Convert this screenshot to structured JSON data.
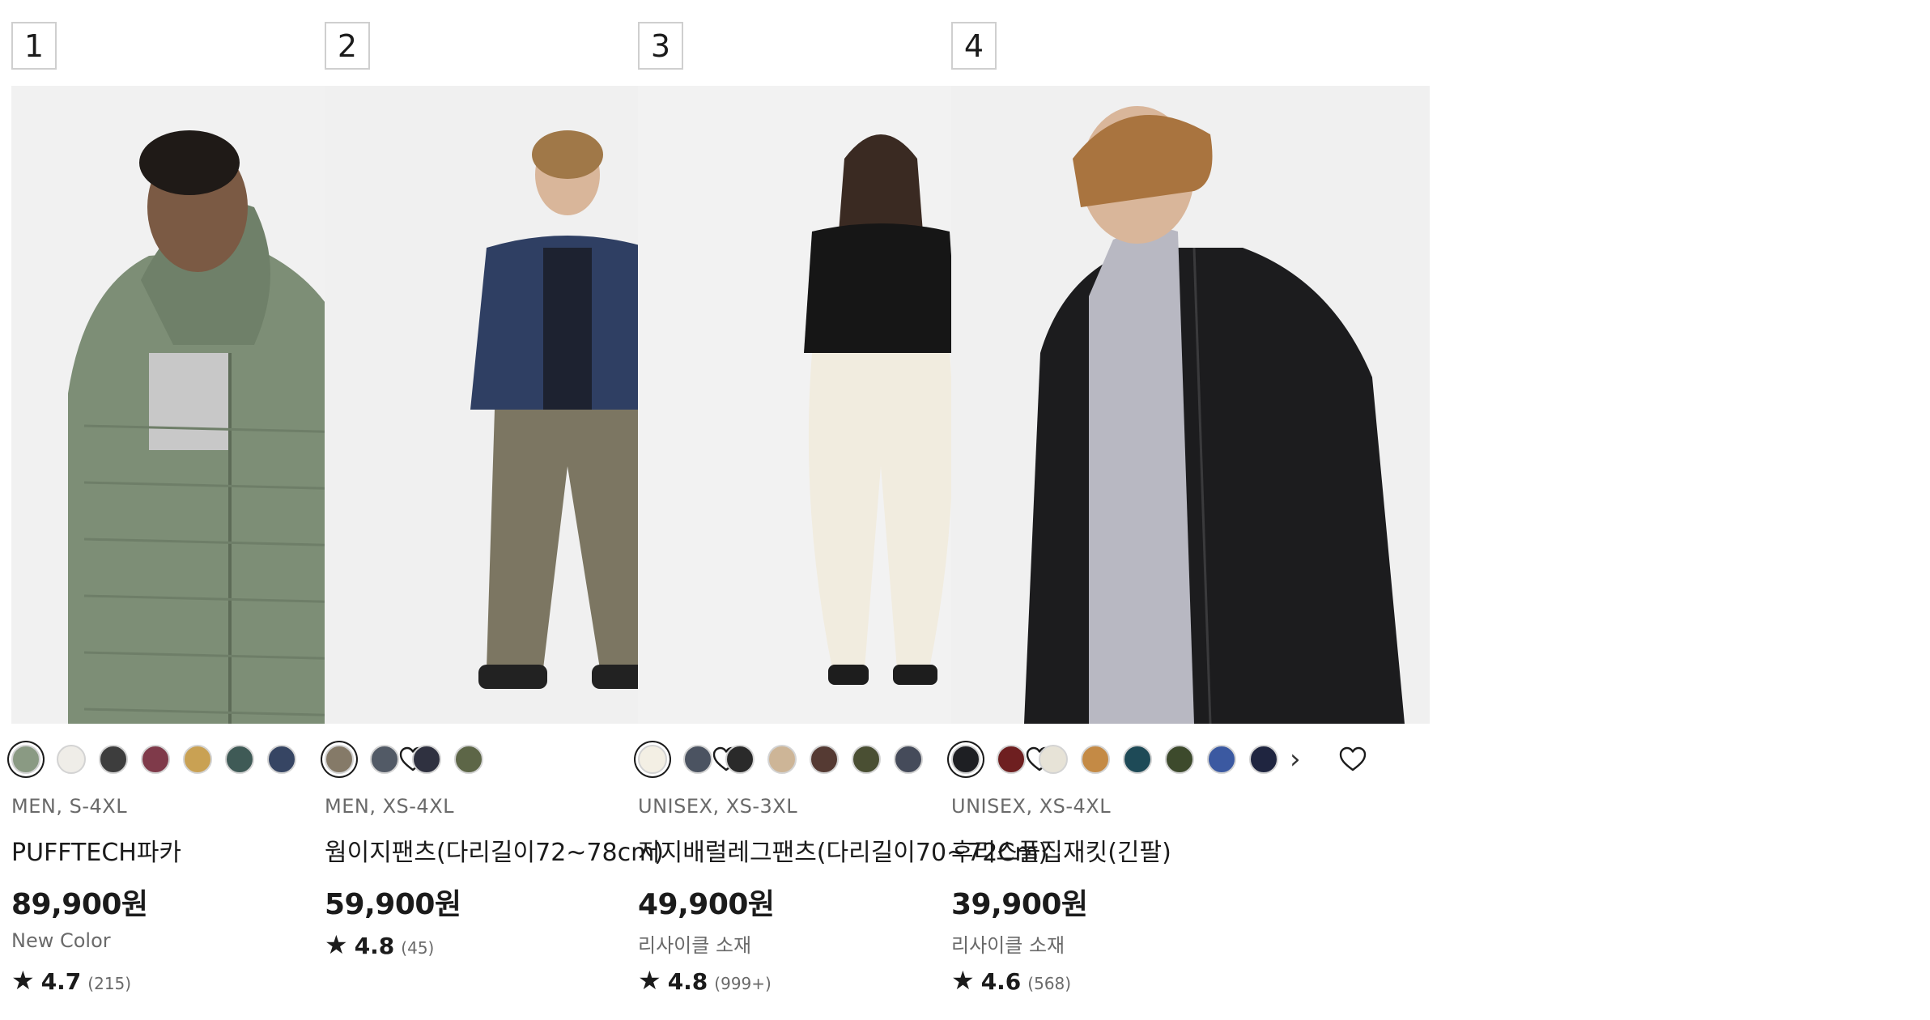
{
  "products": [
    {
      "rank": "1",
      "meta": "MEN, S-4XL",
      "name": "PUFFTECH파카",
      "price": "89,900원",
      "note": "New Color",
      "rating": {
        "star": "★",
        "score": "4.7",
        "count": "(215)"
      },
      "colors": [
        "#8a9a83",
        "#efede8",
        "#3d3d3d",
        "#7f3a4a",
        "#c9a153",
        "#3f5a56",
        "#364563"
      ],
      "selected_color": 0,
      "has_more": false,
      "photo_bg": "#f1f1f1",
      "product_color": "#7d8e76"
    },
    {
      "rank": "2",
      "meta": "MEN, XS-4XL",
      "name": "웜이지팬츠(다리길이72~78cm)",
      "price": "59,900원",
      "note": "",
      "rating": {
        "star": "★",
        "score": "4.8",
        "count": "(45)"
      },
      "colors": [
        "#857a68",
        "#525a66",
        "#2f3140",
        "#5d6647"
      ],
      "selected_color": 0,
      "has_more": false,
      "photo_bg": "#f0f0f0",
      "product_color": "#7c7662"
    },
    {
      "rank": "3",
      "meta": "UNISEX, XS-3XL",
      "name": "저지배럴레그팬츠(다리길이70~72Cm)",
      "price": "49,900원",
      "note": "리사이클 소재",
      "rating": {
        "star": "★",
        "score": "4.8",
        "count": "(999+)"
      },
      "colors": [
        "#f3efe4",
        "#4b5361",
        "#2a2a2a",
        "#cdb597",
        "#553a33",
        "#4a4f33",
        "#454b5a"
      ],
      "selected_color": 0,
      "has_more": false,
      "photo_bg": "#f2f2f2",
      "product_color": "#f1ecdf"
    },
    {
      "rank": "4",
      "meta": "UNISEX, XS-4XL",
      "name": "후리스풀집재킷(긴팔)",
      "price": "39,900원",
      "note": "리사이클 소재",
      "rating": {
        "star": "★",
        "score": "4.6",
        "count": "(568)"
      },
      "colors": [
        "#1e1f23",
        "#6e1f20",
        "#e7e3d7",
        "#c48a45",
        "#1e4a57",
        "#3d4a2c",
        "#3b59a1",
        "#1f2540"
      ],
      "selected_color": 0,
      "has_more": true,
      "more_glyph": "›",
      "photo_bg": "#f0f0f0",
      "product_color": "#1c1c1e"
    }
  ],
  "icons": {
    "favorite": "heart-outline-icon",
    "more_colors": "chevron-right-icon",
    "star": "star-icon"
  }
}
